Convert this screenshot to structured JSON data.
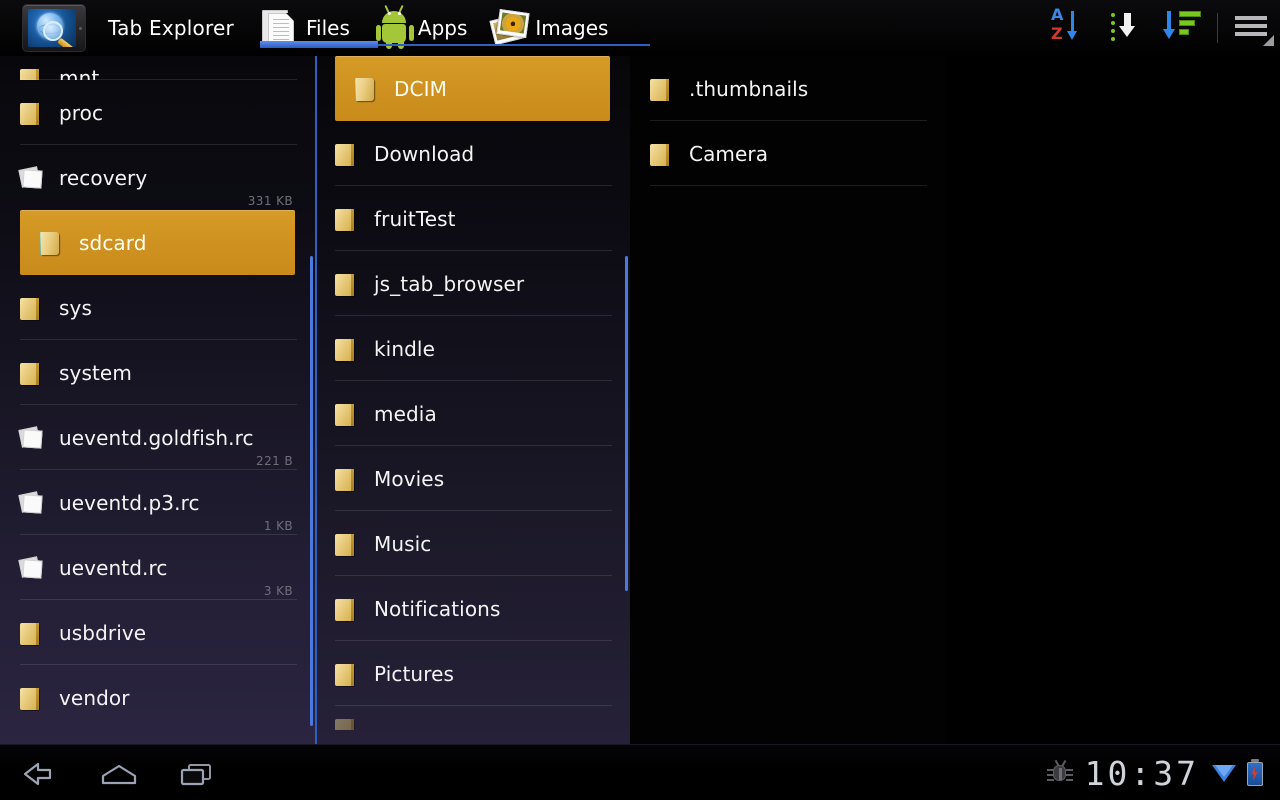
{
  "app": {
    "title": "Tab Explorer",
    "icon": "tablet-magnifier-icon"
  },
  "tabs": [
    {
      "label": "Files",
      "icon": "documents-icon",
      "active": true
    },
    {
      "label": "Apps",
      "icon": "android-robot-icon",
      "active": false
    },
    {
      "label": "Images",
      "icon": "photos-sunflower-icon",
      "active": false
    }
  ],
  "toolbar": {
    "sort_alpha_label": "AZ",
    "items": [
      {
        "name": "sort-alphabetical-icon"
      },
      {
        "name": "sort-download-icon"
      },
      {
        "name": "sort-by-size-icon"
      },
      {
        "name": "overflow-menu-icon"
      }
    ]
  },
  "colors": {
    "selection": "#cf9220",
    "accent_blue": "#2f5fc0",
    "scrollbar": "#4a7ae0",
    "folder": "#e8cb7e",
    "text": "#f4f4f4",
    "size_text": "#6e6e7a"
  },
  "columns": [
    {
      "name": "root-listing",
      "path_level": "root",
      "rows": [
        {
          "label": "mnt",
          "icon": "folder-icon",
          "size": "",
          "selected": false,
          "clipped": true
        },
        {
          "label": "proc",
          "icon": "folder-icon",
          "size": "",
          "selected": false
        },
        {
          "label": "recovery",
          "icon": "file-icon",
          "size": "331 KB",
          "selected": false
        },
        {
          "label": "sdcard",
          "icon": "sdcard-icon",
          "size": "",
          "selected": true
        },
        {
          "label": "sys",
          "icon": "folder-icon",
          "size": "",
          "selected": false
        },
        {
          "label": "system",
          "icon": "folder-icon",
          "size": "",
          "selected": false
        },
        {
          "label": "ueventd.goldfish.rc",
          "icon": "file-icon",
          "size": "221 B",
          "selected": false
        },
        {
          "label": "ueventd.p3.rc",
          "icon": "file-icon",
          "size": "1 KB",
          "selected": false
        },
        {
          "label": "ueventd.rc",
          "icon": "file-icon",
          "size": "3 KB",
          "selected": false
        },
        {
          "label": "usbdrive",
          "icon": "folder-icon",
          "size": "",
          "selected": false
        },
        {
          "label": "vendor",
          "icon": "folder-icon",
          "size": "",
          "selected": false
        }
      ]
    },
    {
      "name": "sdcard-listing",
      "path_level": "sdcard",
      "rows": [
        {
          "label": "DCIM",
          "icon": "sdcard-icon",
          "size": "",
          "selected": true
        },
        {
          "label": "Download",
          "icon": "folder-icon",
          "size": "",
          "selected": false
        },
        {
          "label": "fruitTest",
          "icon": "folder-icon",
          "size": "",
          "selected": false
        },
        {
          "label": "js_tab_browser",
          "icon": "folder-icon",
          "size": "",
          "selected": false
        },
        {
          "label": "kindle",
          "icon": "folder-icon",
          "size": "",
          "selected": false
        },
        {
          "label": "media",
          "icon": "folder-icon",
          "size": "",
          "selected": false
        },
        {
          "label": "Movies",
          "icon": "folder-icon",
          "size": "",
          "selected": false
        },
        {
          "label": "Music",
          "icon": "folder-icon",
          "size": "",
          "selected": false
        },
        {
          "label": "Notifications",
          "icon": "folder-icon",
          "size": "",
          "selected": false
        },
        {
          "label": "Pictures",
          "icon": "folder-icon",
          "size": "",
          "selected": false
        },
        {
          "label": "",
          "icon": "folder-icon",
          "size": "",
          "selected": false,
          "clipped": true
        }
      ]
    },
    {
      "name": "dcim-listing",
      "path_level": "DCIM",
      "rows": [
        {
          "label": ".thumbnails",
          "icon": "folder-icon",
          "size": "",
          "selected": false
        },
        {
          "label": "Camera",
          "icon": "folder-icon",
          "size": "",
          "selected": false
        }
      ]
    },
    {
      "name": "empty-pane",
      "path_level": "",
      "rows": []
    }
  ],
  "system_bar": {
    "nav": [
      {
        "name": "back-icon"
      },
      {
        "name": "home-icon"
      },
      {
        "name": "recent-apps-icon"
      }
    ],
    "clock": "10:37",
    "status_icons": [
      {
        "name": "usb-debug-icon"
      },
      {
        "name": "wifi-icon"
      },
      {
        "name": "battery-charging-icon"
      }
    ]
  }
}
